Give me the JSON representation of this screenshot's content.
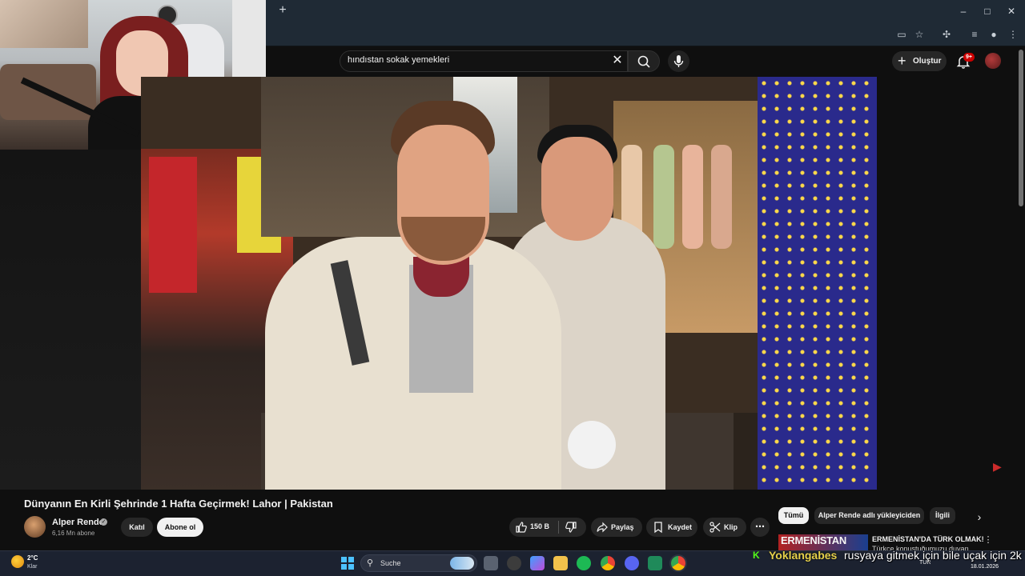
{
  "browser": {
    "new_tab_symbol": "+",
    "window_controls": [
      "–",
      "□",
      "✕"
    ]
  },
  "search": {
    "query": "hındıstan sokak yemekleri",
    "clear_symbol": "✕"
  },
  "header": {
    "create_label": "Oluştur",
    "create_symbol": "+",
    "notification_badge": "9+"
  },
  "video": {
    "title": "Dünyanın En Kirli Şehrinde 1 Hafta Geçirmek! Lahor | Pakistan",
    "channel_name": "Alper Rende",
    "verified_symbol": "✓",
    "subscribers": "6,16 Mn abone",
    "join_label": "Katıl",
    "subscribe_label": "Abone ol",
    "like_count": "150 B",
    "share_label": "Paylaş",
    "save_label": "Kaydet",
    "clip_label": "Klip",
    "more_symbol": "⋯"
  },
  "chips": {
    "all": "Tümü",
    "uploader": "Alper Rende adlı yükleyiciden",
    "related": "İlgili",
    "next_symbol": "›"
  },
  "recommendation": {
    "thumb_text": "ERMENİSTAN",
    "title": "ERMENİSTAN'DA TÜRK OLMAK!",
    "subtitle": "Türkçe konuştuğumuzu duyan...",
    "more_symbol": "⋮"
  },
  "taskbar": {
    "weather_temp": "2°C",
    "weather_desc": "Klar",
    "search_label": "Suche",
    "language": "TUR",
    "date": "18.01.2026"
  },
  "stream_chat": {
    "platform_symbol": "K",
    "username": "Yoklangabes",
    "message": "rusyaya gitmek için bile uçak için 2k"
  },
  "colors": {
    "background": "#0f0f0f",
    "chrome_bar": "#1f2a35",
    "button_bg": "#272727",
    "youtube_red": "#cc0000",
    "kick_green": "#53fc18"
  }
}
